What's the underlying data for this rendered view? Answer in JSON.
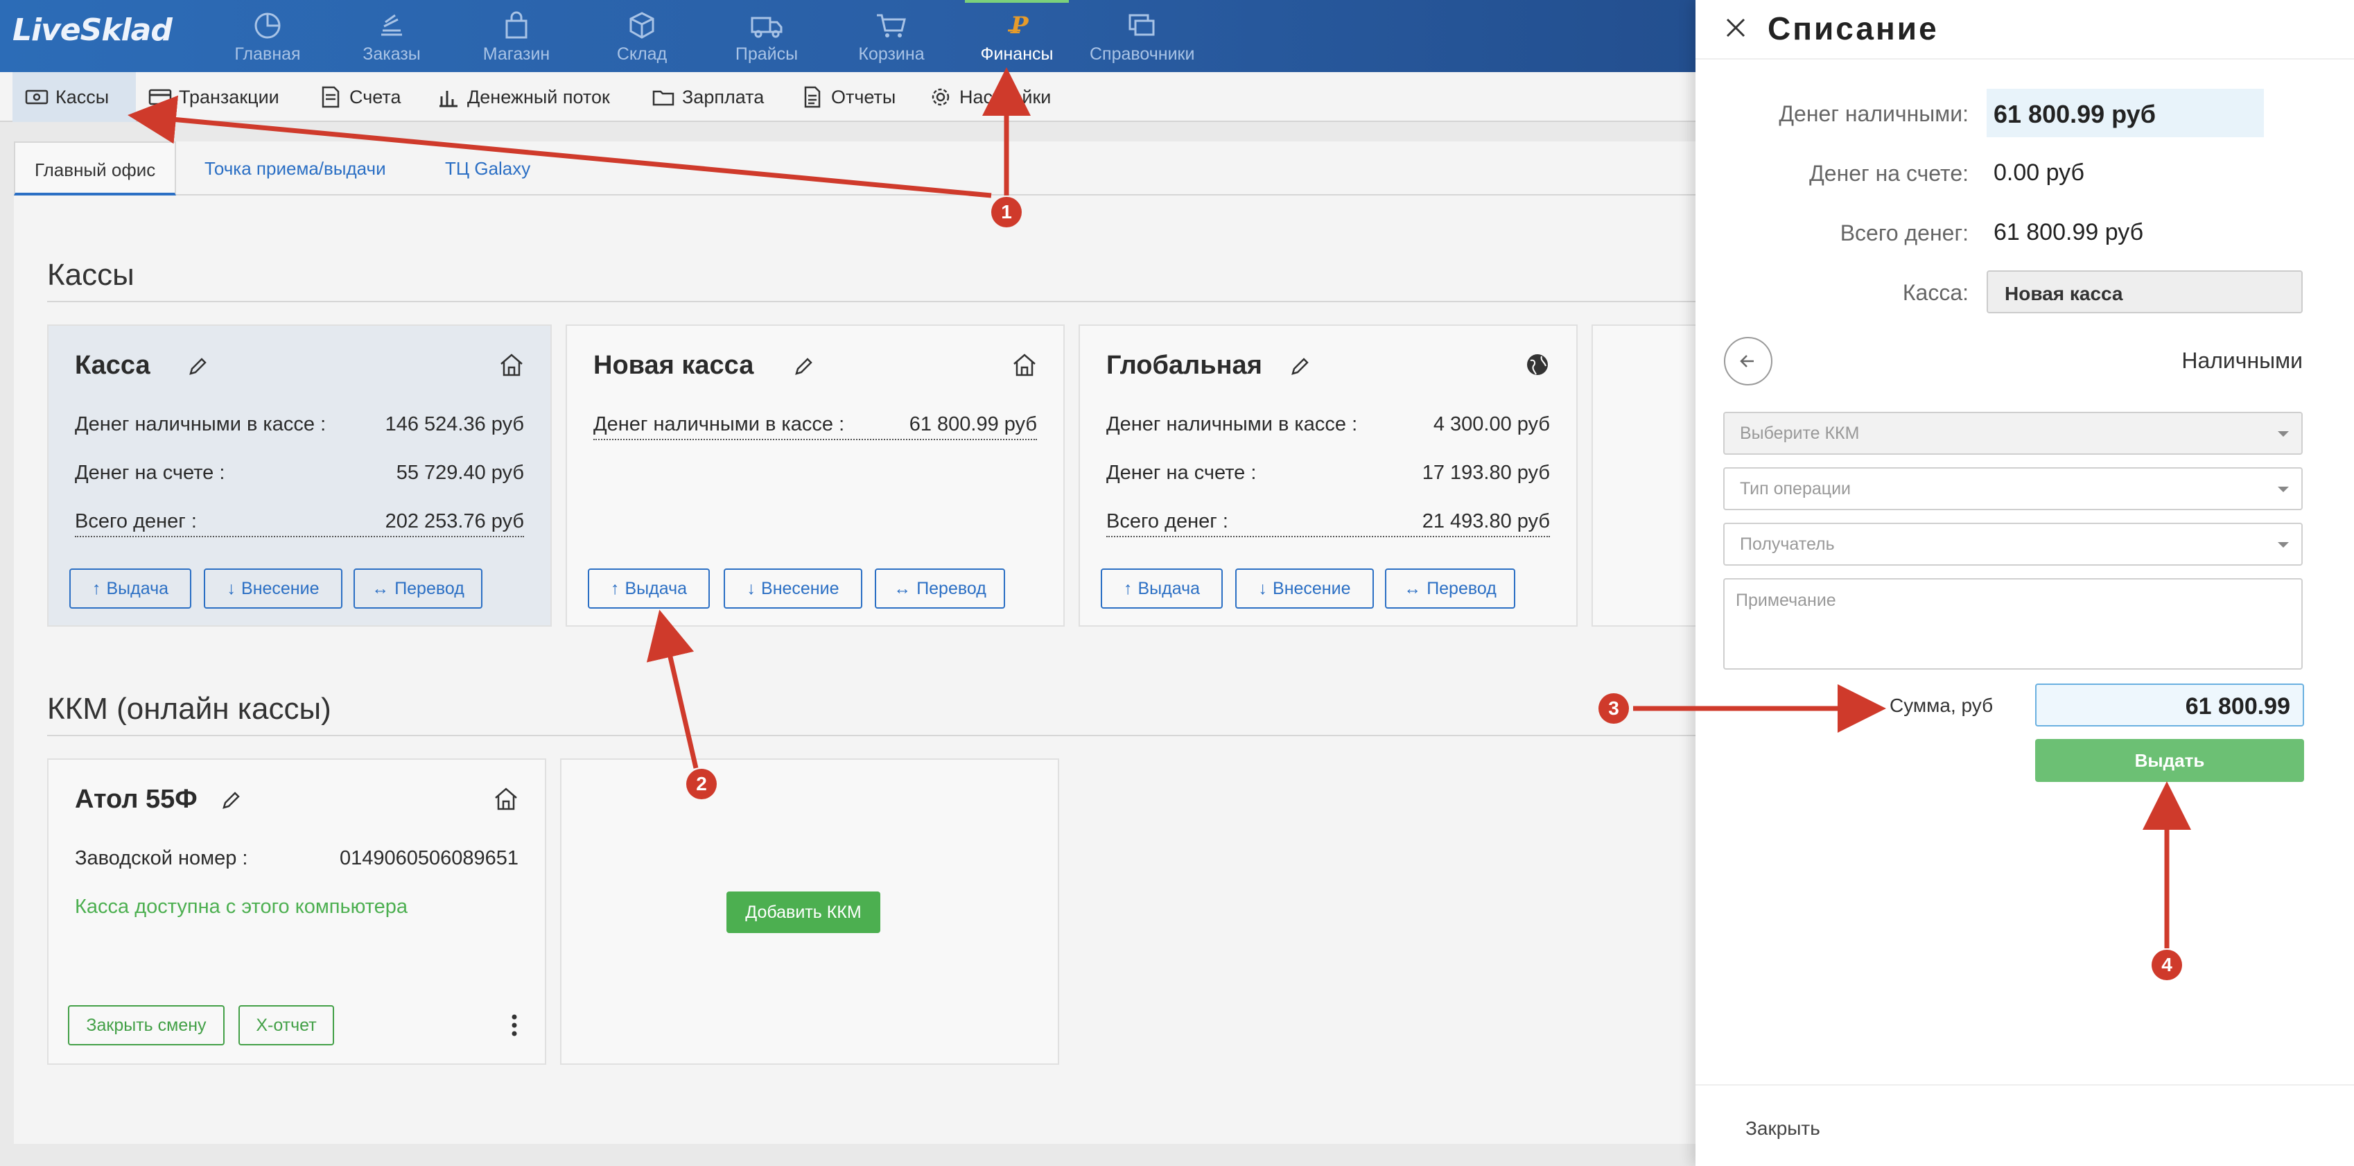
{
  "app": {
    "logo": "LiveSklad"
  },
  "topnav": {
    "items": [
      {
        "label": "Главная",
        "icon": "pie-chart-icon"
      },
      {
        "label": "Заказы",
        "icon": "stack-icon"
      },
      {
        "label": "Магазин",
        "icon": "shopping-bag-icon"
      },
      {
        "label": "Склад",
        "icon": "box-icon"
      },
      {
        "label": "Прайсы",
        "icon": "truck-icon"
      },
      {
        "label": "Корзина",
        "icon": "cart-icon"
      },
      {
        "label": "Финансы",
        "icon": "ruble-icon",
        "active": true
      },
      {
        "label": "Справочники",
        "icon": "copy-icon"
      }
    ]
  },
  "subnav": {
    "items": [
      {
        "label": "Кассы",
        "icon": "cash-icon",
        "active": true
      },
      {
        "label": "Транзакции",
        "icon": "card-icon"
      },
      {
        "label": "Счета",
        "icon": "invoice-icon"
      },
      {
        "label": "Денежный поток",
        "icon": "bars-icon"
      },
      {
        "label": "Зарплата",
        "icon": "folder-icon"
      },
      {
        "label": "Отчеты",
        "icon": "document-icon"
      },
      {
        "label": "Настройки",
        "icon": "gear-icon"
      }
    ]
  },
  "tabs": [
    "Главный офис",
    "Точка приема/выдачи",
    "ТЦ Galaxy"
  ],
  "kassy": {
    "title": "Кассы",
    "cards": [
      {
        "name": "Касса",
        "cash_label": "Денег наличными в кассе :",
        "cash": "146 524.36 руб",
        "account_label": "Денег на счете :",
        "account": "55 729.40 руб",
        "total_label": "Всего денег :",
        "total": "202 253.76 руб"
      },
      {
        "name": "Новая касса",
        "cash_label": "Денег наличными в кассе :",
        "cash": "61 800.99 руб"
      },
      {
        "name": "Глобальная",
        "cash_label": "Денег наличными в кассе :",
        "cash": "4 300.00 руб",
        "account_label": "Денег на счете :",
        "account": "17 193.80 руб",
        "total_label": "Всего денег :",
        "total": "21 493.80 руб"
      }
    ],
    "buttons": {
      "out": "Выдача",
      "in": "Внесение",
      "transfer": "Перевод"
    }
  },
  "kkm": {
    "title": "ККМ (онлайн кассы)",
    "device": {
      "name": "Атол 55Ф",
      "serial_label": "Заводской номер :",
      "serial": "0149060506089651",
      "status": "Касса доступна с этого компьютера",
      "close_shift": "Закрыть смену",
      "x_report": "Х-отчет"
    },
    "add_button": "Добавить ККМ"
  },
  "panel": {
    "title": "Списание",
    "cash_label": "Денег наличными:",
    "cash": "61 800.99 руб",
    "account_label": "Денег на счете:",
    "account": "0.00 руб",
    "total_label": "Всего денег:",
    "total": "61 800.99 руб",
    "kassa_label": "Касса:",
    "kassa": "Новая касса",
    "mode": "Наличными",
    "kkm_placeholder": "Выберите ККМ",
    "operation_placeholder": "Тип операции",
    "recipient_placeholder": "Получатель",
    "note_placeholder": "Примечание",
    "amount_label": "Сумма, руб",
    "amount": "61 800.99",
    "submit": "Выдать",
    "close": "Закрыть"
  },
  "callouts": [
    "1",
    "2",
    "3",
    "4"
  ],
  "colors": {
    "accent": "#2b6fc4",
    "green": "#4caf50",
    "callout": "#cf3a2b"
  }
}
